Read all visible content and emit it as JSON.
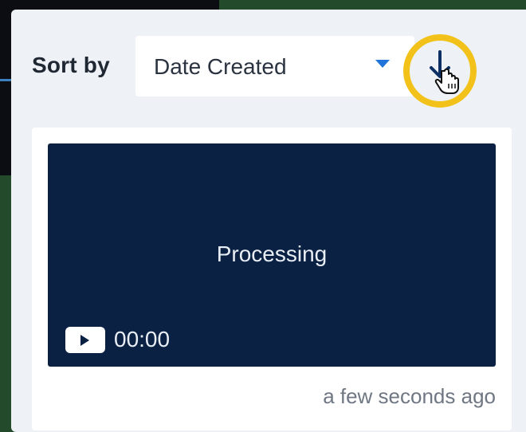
{
  "toolbar": {
    "sort_label": "Sort by",
    "sort_value": "Date Created",
    "sort_direction_icon": "sort-descending-arrow-icon",
    "highlight_color": "#f2c21b",
    "caret_color": "#1e74d8"
  },
  "video_card": {
    "status": "Processing",
    "duration": "00:00",
    "created": "a few seconds ago",
    "thumbnail_color": "#0a2144"
  }
}
